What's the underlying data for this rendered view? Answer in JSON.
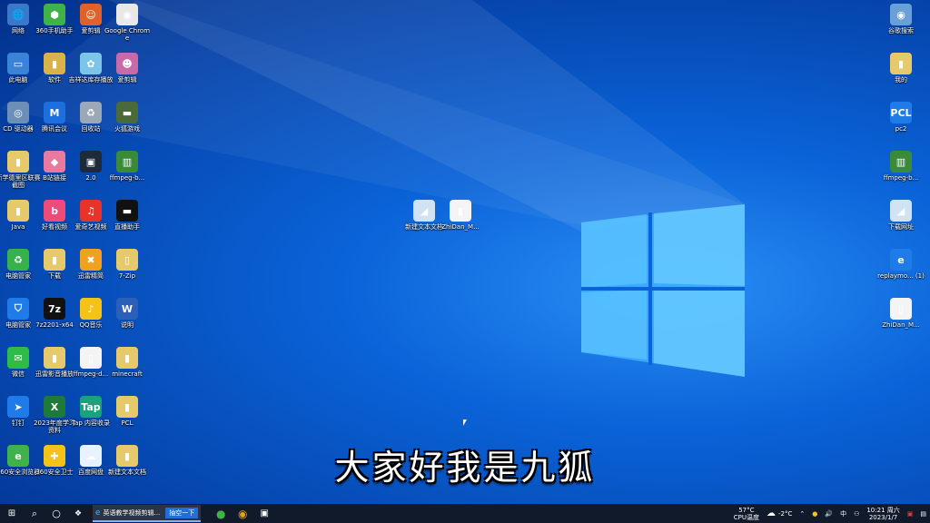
{
  "desktop": {
    "left_icons": [
      {
        "label": "网络",
        "glyph": "🌐",
        "color": "#3a79c9",
        "icon": "network-icon"
      },
      {
        "label": "360手机助手",
        "glyph": "⬢",
        "color": "#3fb24a",
        "icon": "app-icon"
      },
      {
        "label": "爱剪辑",
        "glyph": "☺",
        "color": "#e0622a",
        "icon": "app-icon"
      },
      {
        "label": "Google Chrome",
        "glyph": "◉",
        "color": "#e8e8e8",
        "icon": "chrome-icon"
      },
      {
        "label": "此电脑",
        "glyph": "▭",
        "color": "#3a83d6",
        "icon": "computer-icon"
      },
      {
        "label": "软件",
        "glyph": "▮",
        "color": "#d9b24a",
        "icon": "folder-icon"
      },
      {
        "label": "吉祥达库存播放",
        "glyph": "✿",
        "color": "#7cc5e8",
        "icon": "app-icon"
      },
      {
        "label": "爱剪辑",
        "glyph": "☻",
        "color": "#c96aa8",
        "icon": "app-icon"
      },
      {
        "label": "CD 驱动器",
        "glyph": "◎",
        "color": "#6c8fb8",
        "icon": "drive-icon"
      },
      {
        "label": "腾讯会议",
        "glyph": "M",
        "color": "#1d6fe0",
        "icon": "app-icon"
      },
      {
        "label": "回收站",
        "glyph": "♻",
        "color": "#9aa8b8",
        "icon": "recycle-bin-icon"
      },
      {
        "label": "火狐游戏",
        "glyph": "▬",
        "color": "#4a6a3a",
        "icon": "app-icon"
      },
      {
        "label": "新学德里区联赛截图",
        "glyph": "▮",
        "color": "#e6c96a",
        "icon": "folder-icon"
      },
      {
        "label": "B站链接",
        "glyph": "◆",
        "color": "#e87aa0",
        "icon": "app-icon"
      },
      {
        "label": "2.0",
        "glyph": "▣",
        "color": "#1c2a3a",
        "icon": "app-icon"
      },
      {
        "label": "ffmpeg-b...",
        "glyph": "▥",
        "color": "#3a8a3a",
        "icon": "archive-icon"
      },
      {
        "label": "Java",
        "glyph": "▮",
        "color": "#e6c96a",
        "icon": "folder-icon"
      },
      {
        "label": "好看视频",
        "glyph": "b",
        "color": "#f04a7a",
        "icon": "app-icon"
      },
      {
        "label": "爱奇艺视频",
        "glyph": "♫",
        "color": "#e8332a",
        "icon": "app-icon"
      },
      {
        "label": "直播助手",
        "glyph": "▬",
        "color": "#111111",
        "icon": "app-icon"
      },
      {
        "label": "电脑管家",
        "glyph": "♻",
        "color": "#36b24a",
        "icon": "app-icon"
      },
      {
        "label": "下载",
        "glyph": "▮",
        "color": "#e6c96a",
        "icon": "folder-icon"
      },
      {
        "label": "迅雷精简",
        "glyph": "✖",
        "color": "#f2a020",
        "icon": "app-icon"
      },
      {
        "label": "7-Zip",
        "glyph": "▯",
        "color": "#e6c96a",
        "icon": "folder-icon"
      },
      {
        "label": "电脑管家",
        "glyph": "⛉",
        "color": "#1f7be8",
        "icon": "shield-icon"
      },
      {
        "label": "7z2201-x64",
        "glyph": "7z",
        "color": "#111111",
        "icon": "app-icon"
      },
      {
        "label": "QQ音乐",
        "glyph": "♪",
        "color": "#f5c21a",
        "icon": "app-icon"
      },
      {
        "label": "说明",
        "glyph": "W",
        "color": "#2b5fb8",
        "icon": "word-icon"
      },
      {
        "label": "微信",
        "glyph": "✉",
        "color": "#2dbb4a",
        "icon": "wechat-icon"
      },
      {
        "label": "迅雷影音播放",
        "glyph": "▮",
        "color": "#e6c96a",
        "icon": "folder-icon"
      },
      {
        "label": "ffmpeg-d...",
        "glyph": "▯",
        "color": "#f4f4f4",
        "icon": "file-icon"
      },
      {
        "label": "minecraft",
        "glyph": "▮",
        "color": "#e6c96a",
        "icon": "folder-icon"
      },
      {
        "label": "钉钉",
        "glyph": "➤",
        "color": "#1f7be8",
        "icon": "app-icon"
      },
      {
        "label": "2023年度学习资料",
        "glyph": "X",
        "color": "#1f7a3a",
        "icon": "excel-icon"
      },
      {
        "label": "Tap 内容收录",
        "glyph": "Tap",
        "color": "#1aa37a",
        "icon": "app-icon"
      },
      {
        "label": "PCL",
        "glyph": "▮",
        "color": "#e6c96a",
        "icon": "folder-icon"
      },
      {
        "label": "360安全浏览器",
        "glyph": "e",
        "color": "#3fb24a",
        "icon": "app-icon"
      },
      {
        "label": "360安全卫士",
        "glyph": "✚",
        "color": "#f5c21a",
        "icon": "app-icon"
      },
      {
        "label": "百度网盘",
        "glyph": "☁",
        "color": "#e8f2ff",
        "icon": "app-icon"
      },
      {
        "label": "新建文本文档",
        "glyph": "▮",
        "color": "#e6c96a",
        "icon": "folder-icon"
      }
    ],
    "right_icons": [
      {
        "label": "谷歌搜索",
        "glyph": "◉",
        "color": "#6aa0d8",
        "icon": "app-icon"
      },
      {
        "label": "我的",
        "glyph": "▮",
        "color": "#e6c96a",
        "icon": "folder-icon"
      },
      {
        "label": "pc2",
        "glyph": "PCL",
        "color": "#1f7be8",
        "icon": "app-icon"
      },
      {
        "label": "ffmpeg-b...",
        "glyph": "▥",
        "color": "#3a8a3a",
        "icon": "archive-icon"
      },
      {
        "label": "下载网址",
        "glyph": "◢",
        "color": "#cfe3f4",
        "icon": "shortcut-icon"
      },
      {
        "label": "replaymo... (1)",
        "glyph": "e",
        "color": "#1f7be8",
        "icon": "ie-icon"
      },
      {
        "label": "ZhiDan_M...",
        "glyph": "▯",
        "color": "#f4f4f4",
        "icon": "file-icon"
      }
    ],
    "middle_icons": [
      {
        "label": "新建文本文档",
        "glyph": "◢",
        "color": "#cfe3f4",
        "icon": "shortcut-icon"
      },
      {
        "label": "ZhiDan_M...",
        "glyph": "▮",
        "color": "#f4f4f4",
        "icon": "file-icon"
      }
    ]
  },
  "subtitle": "大家好我是九狐",
  "taskbar": {
    "active_task_label": "英语教学视频剪辑...",
    "active_task_extra": "抽空一下",
    "cpu_temp": "57°C",
    "cpu_label": "CPU温度",
    "weather_temp": "-2°C",
    "ime": "中",
    "time": "10:21 周六",
    "date": "2023/1/7"
  }
}
